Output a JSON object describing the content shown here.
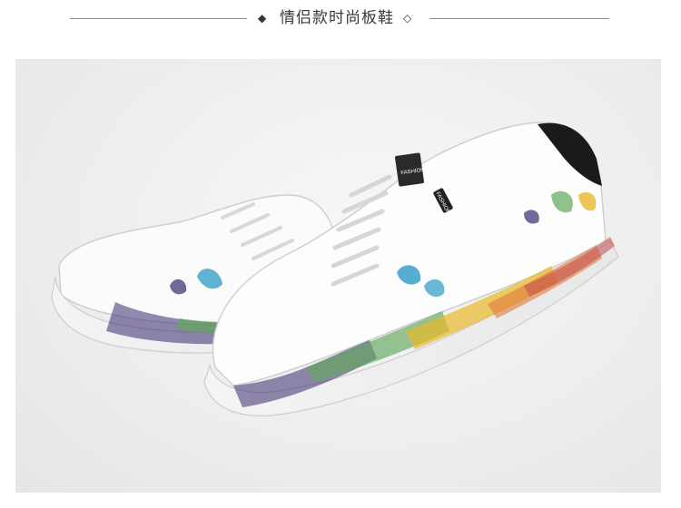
{
  "header": {
    "title": "情侣款时尚板鞋",
    "left_icon": "diamond-filled-icon",
    "right_icon": "diamond-outline-icon"
  },
  "product_image": {
    "subject": "pair of white sneakers with colorful paint splatter",
    "tongue_label_text": "FASHION",
    "side_label_text": "FASHION",
    "colors": {
      "shoe": "#ffffff",
      "heel_tab": "#1a1a1a",
      "splatter": [
        "#3a2a6e",
        "#5fa85a",
        "#e8b82a",
        "#e0793a",
        "#c24a4a",
        "#3aa0c8"
      ]
    }
  }
}
